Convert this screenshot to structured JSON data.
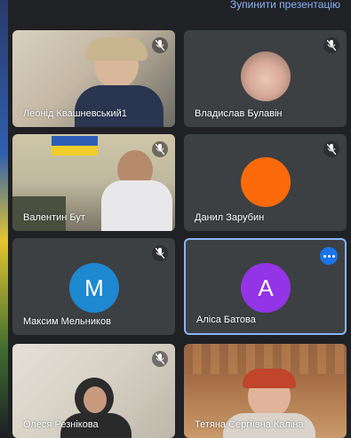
{
  "header": {
    "stop_presentation": "Зупинити презентацію"
  },
  "participants": [
    {
      "name": "Леонід Квашневський1",
      "muted": true,
      "video": true
    },
    {
      "name": "Владислав Булавін",
      "muted": true,
      "video": true
    },
    {
      "name": "Валентин Бут",
      "muted": true,
      "video": true
    },
    {
      "name": "Данил Зарубин",
      "muted": true,
      "video": false,
      "avatar_color": "#fa6a0a"
    },
    {
      "name": "Максим Мельников",
      "muted": true,
      "video": false,
      "avatar_letter": "M",
      "avatar_color": "#1e88d0"
    },
    {
      "name": "Аліса Батова",
      "muted": false,
      "video": false,
      "avatar_letter": "A",
      "avatar_color": "#9334e6",
      "active_speaker": true
    },
    {
      "name": "Олеся Резнікова",
      "muted": true,
      "video": true
    },
    {
      "name": "Тетяна Сергіївна Каліна",
      "muted": false,
      "video": true
    }
  ],
  "colors": {
    "background": "#202124",
    "tile": "#3c4043",
    "accent": "#8ab4f8",
    "more_button": "#1a73e8"
  }
}
